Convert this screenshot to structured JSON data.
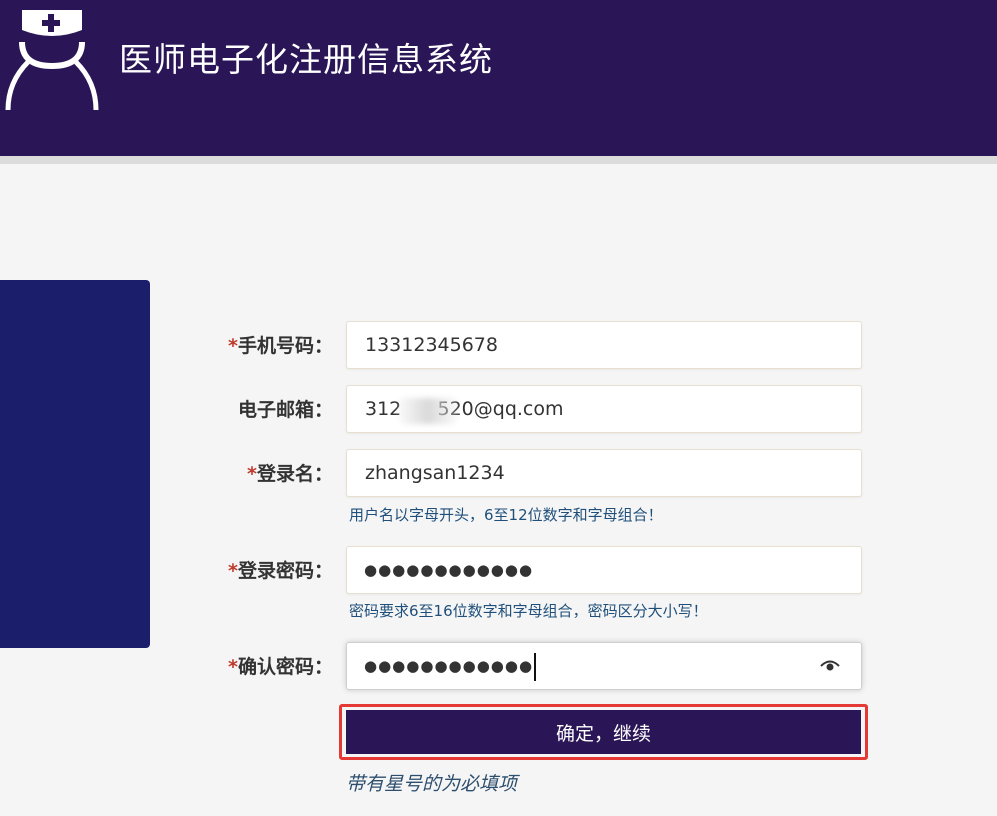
{
  "header": {
    "title": "医师电子化注册信息系统",
    "logo_icon": "nurse-cap-person-icon",
    "bg_color": "#2a1557"
  },
  "form": {
    "fields": [
      {
        "label": "手机号码：",
        "required": true,
        "value": "13312345678"
      },
      {
        "label": "电子邮箱：",
        "required": false,
        "value": "312      520@qq.com"
      },
      {
        "label": "登录名：",
        "required": true,
        "value": "zhangsan1234",
        "hint": "用户名以字母开头，6至12位数字和字母组合！"
      },
      {
        "label": "登录密码：",
        "required": true,
        "value": "●●●●●●●●●●●●",
        "hint": "密码要求6至16位数字和字母组合，密码区分大小写！"
      },
      {
        "label": "确认密码：",
        "required": true,
        "value": "●●●●●●●●●●●●",
        "icon": "eye-icon"
      }
    ],
    "required_mark": "*",
    "submit_label": "确定，继续",
    "footnote": "带有星号的为必填项"
  },
  "colors": {
    "accent": "#2a1557",
    "side_panel": "#1b1f6b",
    "required": "#c0392b",
    "highlight_frame": "#e53935",
    "hint": "#1f4f7a"
  }
}
